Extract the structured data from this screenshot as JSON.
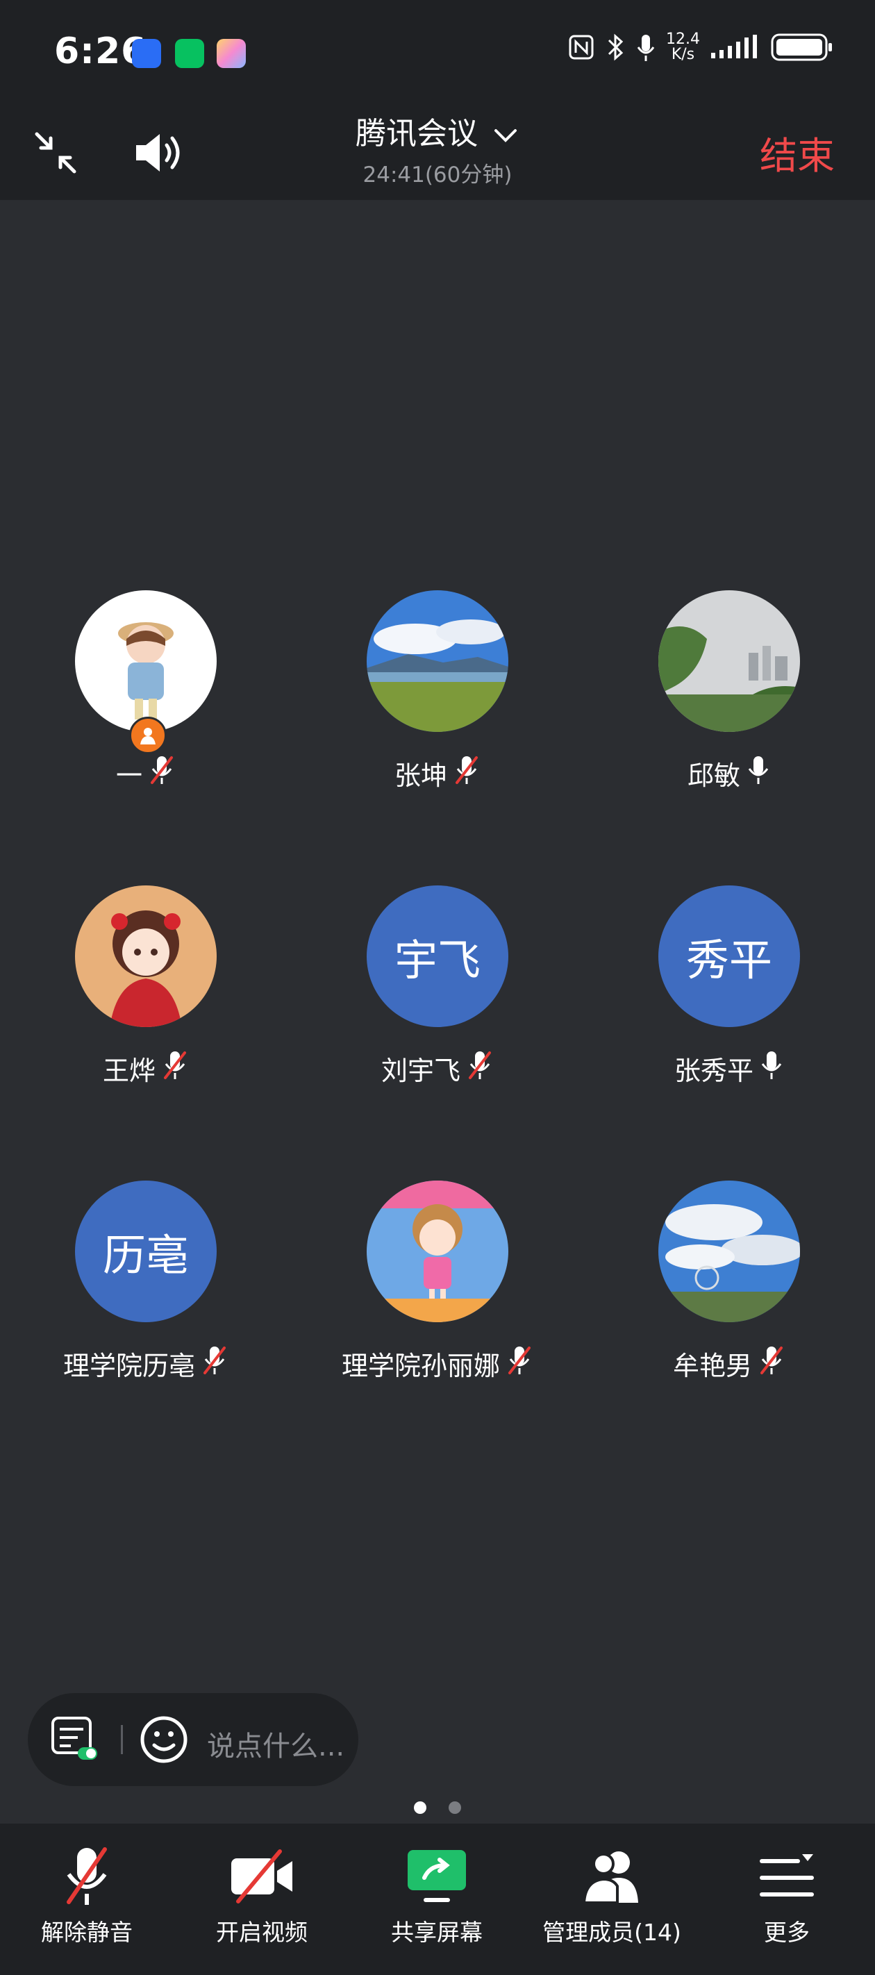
{
  "status_bar": {
    "time": "6:26",
    "net_speed_value": "12.4",
    "net_speed_unit": "K/s"
  },
  "header": {
    "title": "腾讯会议",
    "timer": "24:41(60分钟)",
    "end_label": "结束"
  },
  "participants": [
    {
      "name": "一",
      "avatar_text": "",
      "avatar_kind": "photo-doll",
      "mic": "muted",
      "host": true
    },
    {
      "name": "张坤",
      "avatar_text": "",
      "avatar_kind": "photo-landscape",
      "mic": "muted",
      "host": false
    },
    {
      "name": "邱敏",
      "avatar_text": "",
      "avatar_kind": "photo-city",
      "mic": "on",
      "host": false
    },
    {
      "name": "王烨",
      "avatar_text": "",
      "avatar_kind": "photo-cartoon-girl",
      "mic": "muted",
      "host": false
    },
    {
      "name": "刘宇飞",
      "avatar_text": "宇飞",
      "avatar_kind": "text",
      "mic": "muted",
      "host": false
    },
    {
      "name": "张秀平",
      "avatar_text": "秀平",
      "avatar_kind": "text",
      "mic": "on",
      "host": false
    },
    {
      "name": "理学院历亳",
      "avatar_text": "历亳",
      "avatar_kind": "text",
      "mic": "muted",
      "host": false
    },
    {
      "name": "理学院孙丽娜",
      "avatar_text": "",
      "avatar_kind": "photo-cartoon-pink",
      "mic": "muted",
      "host": false
    },
    {
      "name": "牟艳男",
      "avatar_text": "",
      "avatar_kind": "photo-sky",
      "mic": "muted",
      "host": false
    }
  ],
  "chat": {
    "placeholder": "说点什么..."
  },
  "page_indicator": {
    "current": 1,
    "total": 2
  },
  "toolbar": [
    {
      "label": "解除静音",
      "icon": "mic-off-icon"
    },
    {
      "label": "开启视频",
      "icon": "video-off-icon"
    },
    {
      "label": "共享屏幕",
      "icon": "share-screen-icon"
    },
    {
      "label": "管理成员(14)",
      "icon": "members-icon"
    },
    {
      "label": "更多",
      "icon": "more-icon"
    }
  ],
  "colors": {
    "end": "#f0494a",
    "avatar_bg": "#3f6cc0",
    "share_green": "#1fbf6a",
    "host_badge": "#f2771f"
  }
}
